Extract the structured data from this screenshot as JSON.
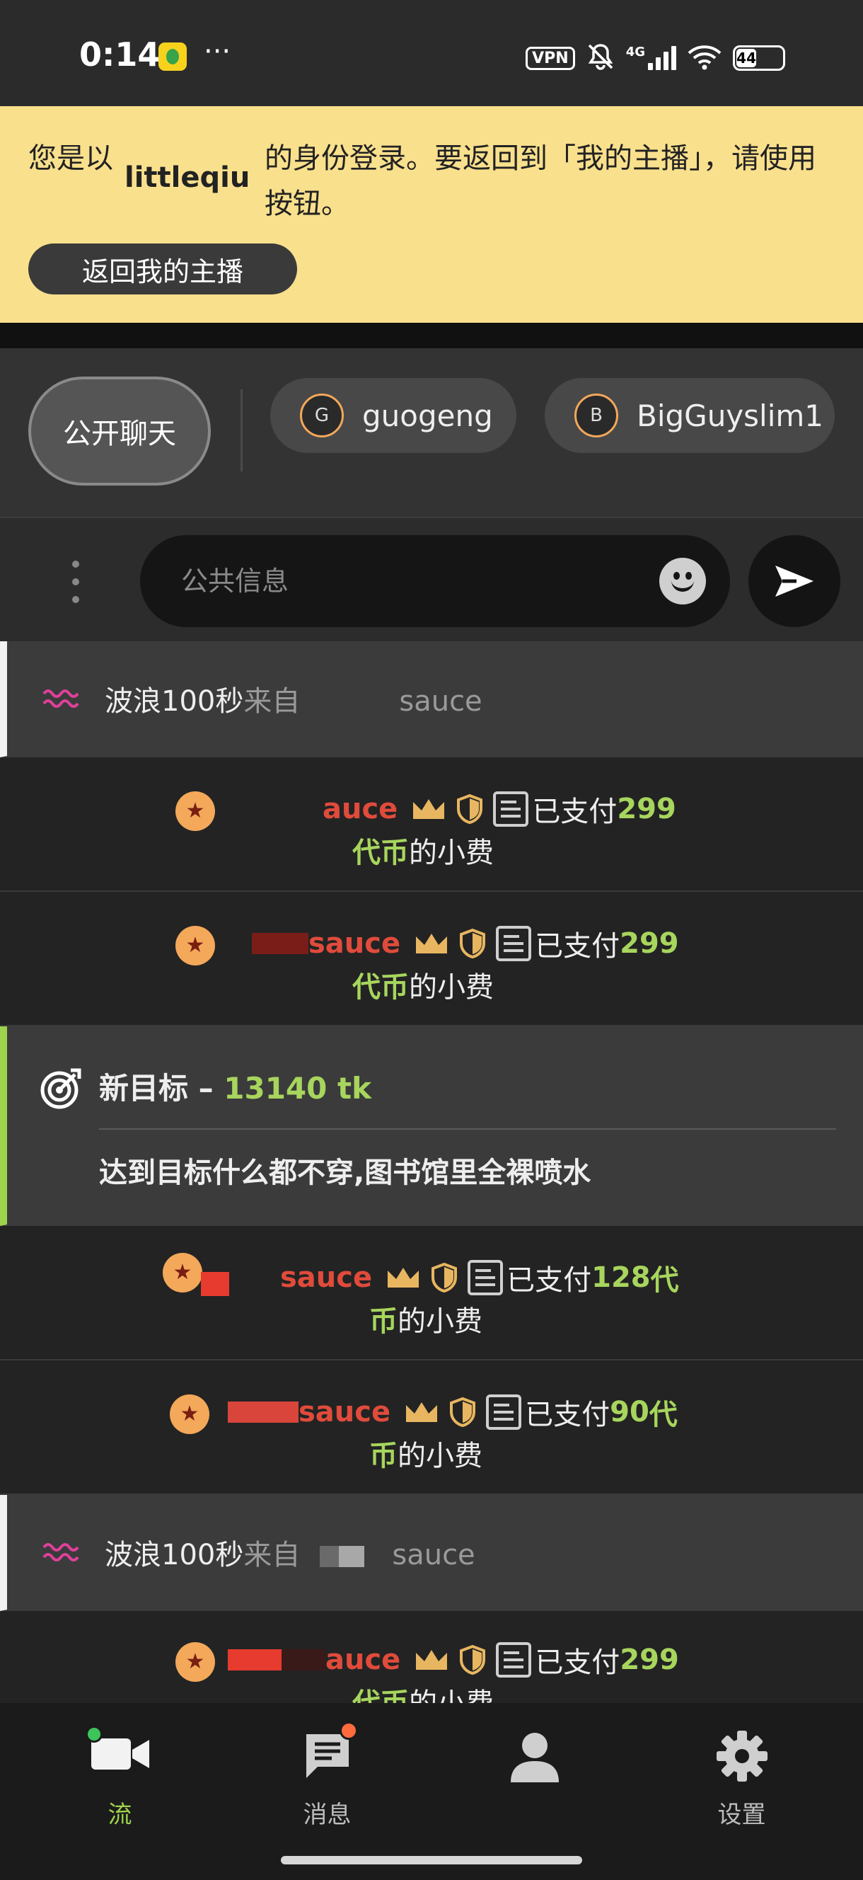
{
  "status_bar": {
    "time": "0:14",
    "dots": "···",
    "vpn": "VPN",
    "network": "4G",
    "battery": "44",
    "icons": [
      "app-icon",
      "mute-icon",
      "signal-icon",
      "wifi-icon",
      "battery-icon"
    ]
  },
  "banner": {
    "text_pre": "您是以",
    "username": "littleqiu",
    "text_post": "的身份登录。要返回到「我的主播」，请使用按钮。",
    "button_label": "返回我的主播"
  },
  "chat_tabs": [
    {
      "label": "公开聊天",
      "active": true
    },
    {
      "label": "guogeng",
      "avatar_letter": "G"
    },
    {
      "label": "BigGuyslim1",
      "avatar_letter": "B"
    }
  ],
  "message_input": {
    "placeholder": "公共信息"
  },
  "feed": {
    "wave1": {
      "prefix": "波浪100秒",
      "from": "来自",
      "user_tail": "sauce"
    },
    "tip1": {
      "user": "auce",
      "paid": "已支付",
      "amount": "299",
      "unit": "代币",
      "suffix": "的小费"
    },
    "tip2": {
      "user": "sauce",
      "paid": "已支付",
      "amount": "299",
      "unit": "代币",
      "suffix": "的小费"
    },
    "goal": {
      "title_prefix": "新目标 – ",
      "tokens": "13140 tk",
      "description": "达到目标什么都不穿,图书馆里全裸喷水"
    },
    "tip3": {
      "user": "sauce",
      "paid": "已支付",
      "amount": "128",
      "unit_first": "代",
      "unit_second": "币",
      "suffix": "的小费"
    },
    "tip4": {
      "user": "sauce",
      "paid": "已支付",
      "amount": "90",
      "unit_first": "代",
      "unit_second": "币",
      "suffix": "的小费"
    },
    "wave2": {
      "prefix": "波浪100秒",
      "from": "来自",
      "user_tail": "sauce"
    },
    "tip5": {
      "user": "auce",
      "paid": "已支付",
      "amount": "299",
      "unit": "代币",
      "suffix": "的小费"
    }
  },
  "bottom_nav": [
    {
      "label": "流",
      "icon": "video-camera-icon",
      "active": true
    },
    {
      "label": "消息",
      "icon": "message-icon"
    },
    {
      "label": "",
      "icon": "person-icon"
    },
    {
      "label": "设置",
      "icon": "gear-icon"
    }
  ],
  "colors": {
    "banner_bg": "#f9e08d",
    "username_red": "#e04b3b",
    "token_green": "#a7d55d",
    "wave_pink": "#e0409a",
    "avatar_orange": "#f3a85a",
    "active_green": "#9fd34b"
  }
}
